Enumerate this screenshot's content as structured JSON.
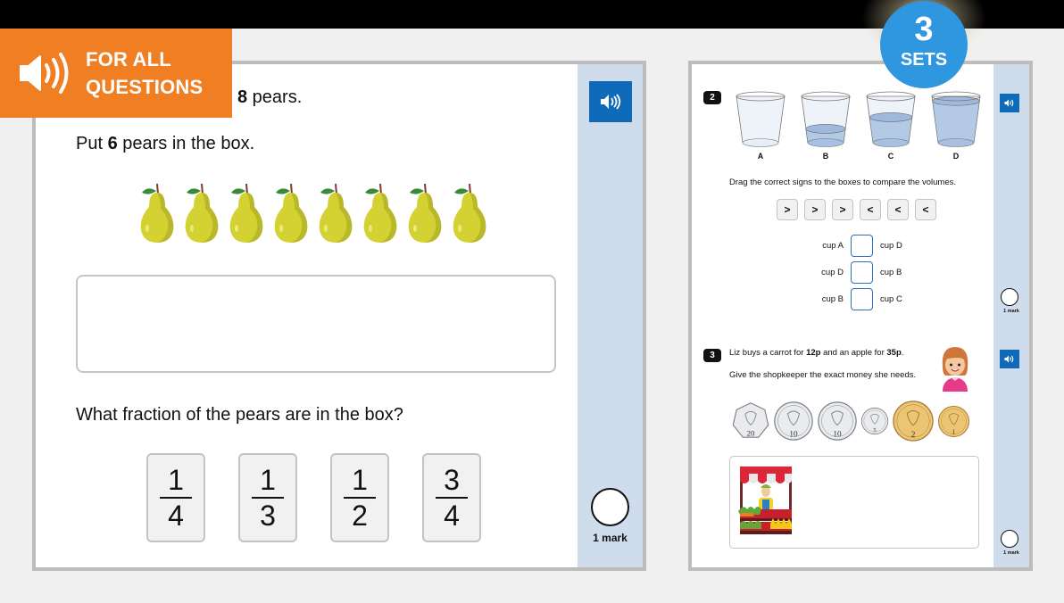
{
  "banner": {
    "icon": "speaker-icon",
    "line1": "FOR ALL",
    "line2": "QUESTIONS",
    "color": "#f07f24"
  },
  "sets_badge": {
    "number": "3",
    "label": "SETS",
    "color": "#2f96e0"
  },
  "question1": {
    "line1_bold": "8",
    "line1_rest": " pears.",
    "line2_pre": "Put ",
    "line2_bold": "6",
    "line2_post": " pears in the box.",
    "pear_count": 8,
    "answer_box_contents": "",
    "question": "What fraction of the pears are in the box?",
    "fraction_options": [
      {
        "numerator": "1",
        "denominator": "4"
      },
      {
        "numerator": "1",
        "denominator": "3"
      },
      {
        "numerator": "1",
        "denominator": "2"
      },
      {
        "numerator": "3",
        "denominator": "4"
      }
    ],
    "audio_icon": "speaker-icon",
    "mark_label": "1 mark"
  },
  "question2": {
    "number": "2",
    "cups": [
      {
        "label": "A",
        "fill_fraction": 0.0
      },
      {
        "label": "B",
        "fill_fraction": 0.3
      },
      {
        "label": "C",
        "fill_fraction": 0.55
      },
      {
        "label": "D",
        "fill_fraction": 0.9
      }
    ],
    "instruction": "Drag the correct signs to the boxes to compare the volumes.",
    "signs": [
      ">",
      ">",
      ">",
      "<",
      "<",
      "<"
    ],
    "comparisons": [
      {
        "left": "cup A",
        "right": "cup D",
        "value": ""
      },
      {
        "left": "cup D",
        "right": "cup B",
        "value": ""
      },
      {
        "left": "cup B",
        "right": "cup C",
        "value": ""
      }
    ],
    "mark_label": "1 mark"
  },
  "question3": {
    "number": "3",
    "line1_pre": "Liz buys a carrot for ",
    "line1_bold1": "12p",
    "line1_mid": " and an apple for ",
    "line1_bold2": "35p",
    "line1_post": ".",
    "line2": "Give the shopkeeper the exact money she needs.",
    "coins": [
      {
        "value": "20",
        "name": "TWENTY PENCE",
        "metal": "silver"
      },
      {
        "value": "10",
        "name": "TEN PENCE",
        "metal": "silver"
      },
      {
        "value": "10",
        "name": "TEN PENCE",
        "metal": "silver"
      },
      {
        "value": "5",
        "name": "FIVE PENCE",
        "metal": "silver"
      },
      {
        "value": "2",
        "name": "TWO PENCE",
        "metal": "copper"
      },
      {
        "value": "1",
        "name": "ONE PENNY",
        "metal": "copper"
      }
    ],
    "mark_label": "1 mark"
  },
  "colors": {
    "audio_button": "#0f6ab9",
    "side_strip": "#cfdcec",
    "panel_border": "#bdbdbd"
  }
}
